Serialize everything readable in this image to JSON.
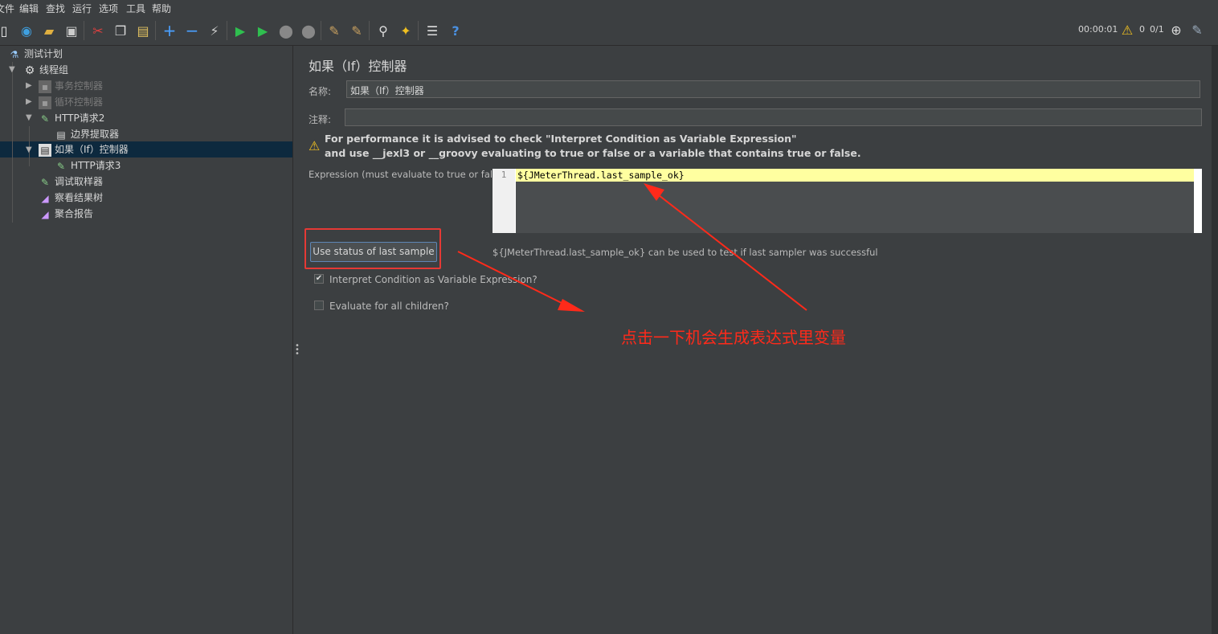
{
  "menu": [
    "文件",
    "编辑",
    "查找",
    "运行",
    "选项",
    "工具",
    "帮助"
  ],
  "status": {
    "elapsed": "00:00:01",
    "warnings": "0",
    "threads": "0/1"
  },
  "tree": [
    {
      "label": "测试计划",
      "icon": "flask-icon",
      "disabled": false
    },
    {
      "label": "线程组",
      "icon": "gear-icon",
      "disabled": false
    },
    {
      "label": "事务控制器",
      "icon": "controller-icon",
      "disabled": true
    },
    {
      "label": "循环控制器",
      "icon": "controller-icon",
      "disabled": true
    },
    {
      "label": "HTTP请求2",
      "icon": "pipette-icon",
      "disabled": false
    },
    {
      "label": "边界提取器",
      "icon": "extractor-icon",
      "disabled": false
    },
    {
      "label": "如果（If）控制器",
      "icon": "if-controller-icon",
      "disabled": false
    },
    {
      "label": "HTTP请求3",
      "icon": "pipette-icon",
      "disabled": false
    },
    {
      "label": "调试取样器",
      "icon": "pipette-icon",
      "disabled": false
    },
    {
      "label": "察看结果树",
      "icon": "chart-icon",
      "disabled": false
    },
    {
      "label": "聚合报告",
      "icon": "chart-icon",
      "disabled": false
    }
  ],
  "panel": {
    "title": "如果（If）控制器",
    "name_label": "名称:",
    "name_value": "如果（If）控制器",
    "comment_label": "注释:",
    "comment_value": "",
    "warning_line1": "For performance it is advised to check \"Interpret Condition as Variable Expression\"",
    "warning_line2": "and use __jexl3 or __groovy evaluating to true or false or a variable that contains true or false.",
    "expression_label": "Expression (must evaluate to true or false)",
    "line_number": "1",
    "expression_value": "${JMeterThread.last_sample_ok}",
    "button_label": "Use status of last sample",
    "hint": "${JMeterThread.last_sample_ok} can be used to test if last sampler was successful",
    "interpret_label": "Interpret Condition as Variable Expression?",
    "interpret_checked": true,
    "evaluate_label": "Evaluate for all children?",
    "evaluate_checked": false
  },
  "annotation": "点击一下机会生成表达式里变量",
  "colors": {
    "annotation": "#ff2a1a",
    "selection": "#0d293e",
    "editor_line": "#ffffa0"
  }
}
